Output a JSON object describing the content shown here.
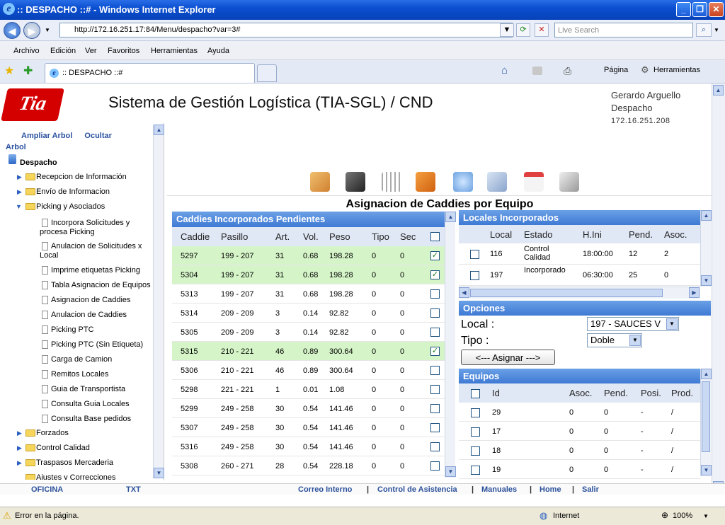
{
  "window": {
    "title": ":: DESPACHO ::# - Windows Internet Explorer"
  },
  "browser": {
    "address": "http://172.16.251.17:84/Menu/despacho?var=3#",
    "search_placeholder": "Live Search",
    "menu": [
      "Archivo",
      "Edición",
      "Ver",
      "Favoritos",
      "Herramientas",
      "Ayuda"
    ],
    "tab_label": ":: DESPACHO ::#",
    "right_tools": {
      "page": "Página",
      "tools": "Herramientas"
    }
  },
  "header": {
    "logo_text": "Tia",
    "title": "Sistema de Gestión Logística (TIA-SGL) / CND",
    "user_name": "Gerardo Arguello",
    "role": "Despacho",
    "ip": "172.16.251.208"
  },
  "tree": {
    "expand_link": "Ampliar Arbol",
    "hide_link_1": "Ocultar",
    "hide_link_2": "Arbol",
    "root": "Despacho",
    "folders": [
      "Recepcion de Información",
      "Envío de Informacion",
      "Picking y Asociados"
    ],
    "docs": [
      "Incorpora Solicitudes y",
      "procesa Picking",
      "Anulacion de Solicitudes x",
      "Local",
      "Imprime etiquetas Picking",
      "Tabla Asignacion de Equipos",
      "Asignacion de Caddies",
      "Anulacion de Caddies",
      "Picking PTC",
      "Picking PTC (Sin Etiqueta)",
      "Carga de Camion",
      "Remitos Locales",
      "Guia de Transportista",
      "Consulta Guia Locales",
      "Consulta Base pedidos"
    ],
    "more_folders": [
      "Forzados",
      "Control Calidad",
      "Traspasos Mercaderia",
      "Ajustes y Correcciones"
    ]
  },
  "main": {
    "title": "Asignacion de Caddies por Equipo"
  },
  "caddies": {
    "header": "Caddies Incorporados Pendientes",
    "columns": [
      "Caddie",
      "Pasillo",
      "Art.",
      "Vol.",
      "Peso",
      "Tipo",
      "Sec"
    ],
    "rows": [
      [
        "5297",
        "199 - 207",
        "31",
        "0.68",
        "198.28",
        "0",
        "0"
      ],
      [
        "5304",
        "199 - 207",
        "31",
        "0.68",
        "198.28",
        "0",
        "0"
      ],
      [
        "5313",
        "199 - 207",
        "31",
        "0.68",
        "198.28",
        "0",
        "0"
      ],
      [
        "5314",
        "209 - 209",
        "3",
        "0.14",
        "92.82",
        "0",
        "0"
      ],
      [
        "5305",
        "209 - 209",
        "3",
        "0.14",
        "92.82",
        "0",
        "0"
      ],
      [
        "5315",
        "210 - 221",
        "46",
        "0.89",
        "300.64",
        "0",
        "0"
      ],
      [
        "5306",
        "210 - 221",
        "46",
        "0.89",
        "300.64",
        "0",
        "0"
      ],
      [
        "5298",
        "221 - 221",
        "1",
        "0.01",
        "1.08",
        "0",
        "0"
      ],
      [
        "5299",
        "249 - 258",
        "30",
        "0.54",
        "141.46",
        "0",
        "0"
      ],
      [
        "5307",
        "249 - 258",
        "30",
        "0.54",
        "141.46",
        "0",
        "0"
      ],
      [
        "5316",
        "249 - 258",
        "30",
        "0.54",
        "141.46",
        "0",
        "0"
      ],
      [
        "5308",
        "260 - 271",
        "28",
        "0.54",
        "228.18",
        "0",
        "0"
      ]
    ],
    "checked": [
      true,
      true,
      false,
      false,
      false,
      true,
      false,
      false,
      false,
      false,
      false,
      false
    ]
  },
  "locales": {
    "header": "Locales Incorporados",
    "columns": [
      "Local",
      "Estado",
      "H.Ini",
      "Pend.",
      "Asoc."
    ],
    "rows": [
      [
        "116",
        "Control Calidad",
        "18:00:00",
        "12",
        "2"
      ],
      [
        "197",
        "Incorporado",
        "06:30:00",
        "25",
        "0"
      ]
    ]
  },
  "opciones": {
    "header": "Opciones",
    "local_label": "Local :",
    "local_value": "197 - SAUCES V",
    "tipo_label": "Tipo :",
    "tipo_value": "Doble",
    "assign_button": "<--- Asignar --->"
  },
  "equipos": {
    "header": "Equipos",
    "columns": [
      "Id",
      "Asoc.",
      "Pend.",
      "Posi.",
      "Prod."
    ],
    "rows": [
      [
        "29",
        "0",
        "0",
        "-",
        "/"
      ],
      [
        "17",
        "0",
        "0",
        "-",
        "/"
      ],
      [
        "18",
        "0",
        "0",
        "-",
        "/"
      ],
      [
        "19",
        "0",
        "0",
        "-",
        "/"
      ]
    ]
  },
  "footer": {
    "left": [
      "OFICINA",
      "TXT"
    ],
    "links": [
      "Correo Interno",
      "Control de Asistencia",
      "Manuales",
      "Home",
      "Salir"
    ],
    "sep": "|"
  },
  "status": {
    "message": "Error en la página.",
    "zone": "Internet",
    "zoom": "100%"
  },
  "colors": {
    "row_selected": "#d5f5c8",
    "panel_header": "#4f86d9",
    "brand": "#d40000"
  }
}
